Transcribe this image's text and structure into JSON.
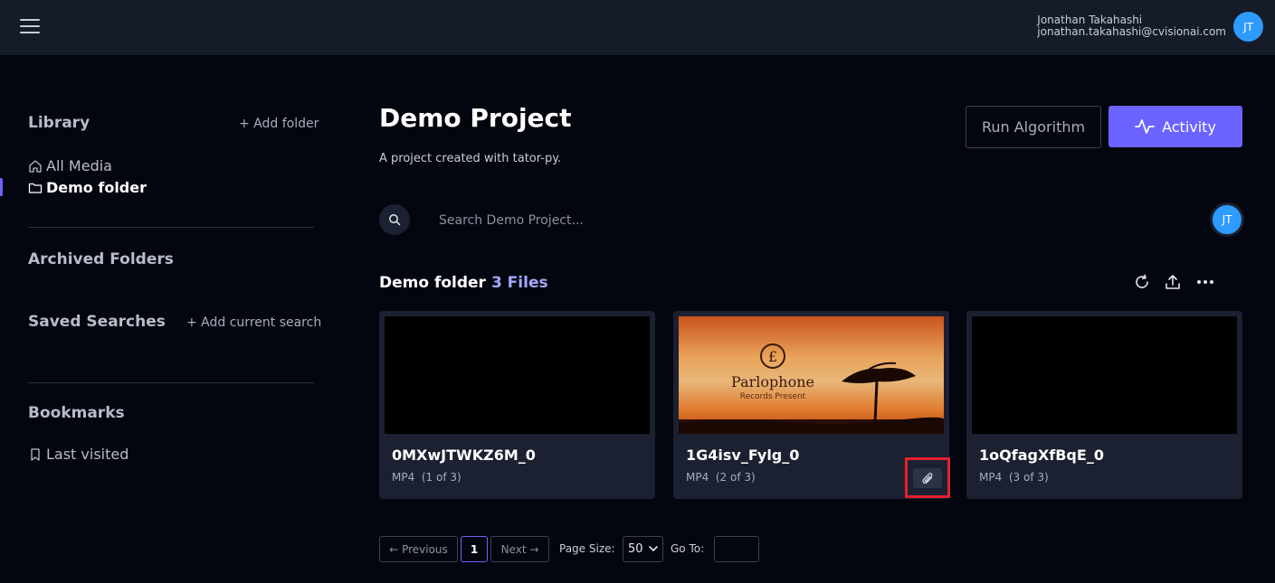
{
  "header": {
    "user_name": "Jonathan Takahashi",
    "user_email": "jonathan.takahashi@cvisionai.com",
    "avatar_initials": "JT",
    "avatar_color": "#2e9bff"
  },
  "sidebar": {
    "library": {
      "title": "Library",
      "add_folder": "+ Add folder",
      "items": [
        {
          "label": "All Media",
          "icon": "home-icon",
          "active": false
        },
        {
          "label": "Demo folder",
          "icon": "folder-icon",
          "active": true
        }
      ]
    },
    "archived": {
      "title": "Archived Folders"
    },
    "saved_searches": {
      "title": "Saved Searches",
      "add_current": "+ Add current search"
    },
    "bookmarks": {
      "title": "Bookmarks",
      "items": [
        {
          "label": "Last visited",
          "icon": "bookmark-icon"
        }
      ]
    }
  },
  "project": {
    "title": "Demo Project",
    "description": "A project created with tator-py.",
    "run_algorithm_label": "Run Algorithm",
    "activity_label": "Activity",
    "accent_color": "#6b63ff"
  },
  "search": {
    "placeholder": "Search Demo Project...",
    "avatar_initials": "JT"
  },
  "folder": {
    "name": "Demo folder",
    "count_label": "3 Files",
    "tools": [
      "refresh-icon",
      "upload-icon",
      "more-icon"
    ]
  },
  "cards": [
    {
      "name": "0MXwJTWKZ6M_0",
      "type": "MP4",
      "position": "(1 of 3)",
      "thumbnail": "black"
    },
    {
      "name": "1G4isv_Fylg_0",
      "type": "MP4",
      "position": "(2 of 3)",
      "thumbnail": "sunset",
      "thumb_brand": "Parlophone",
      "thumb_tagline": "Records Present",
      "attachment_icon": "paperclip-icon"
    },
    {
      "name": "1oQfagXfBqE_0",
      "type": "MP4",
      "position": "(3 of 3)",
      "thumbnail": "black"
    }
  ],
  "pagination": {
    "previous": "← Previous",
    "current_page": "1",
    "next": "Next →",
    "page_size_label": "Page Size:",
    "page_size_value": "50",
    "goto_label": "Go To:",
    "goto_value": ""
  }
}
